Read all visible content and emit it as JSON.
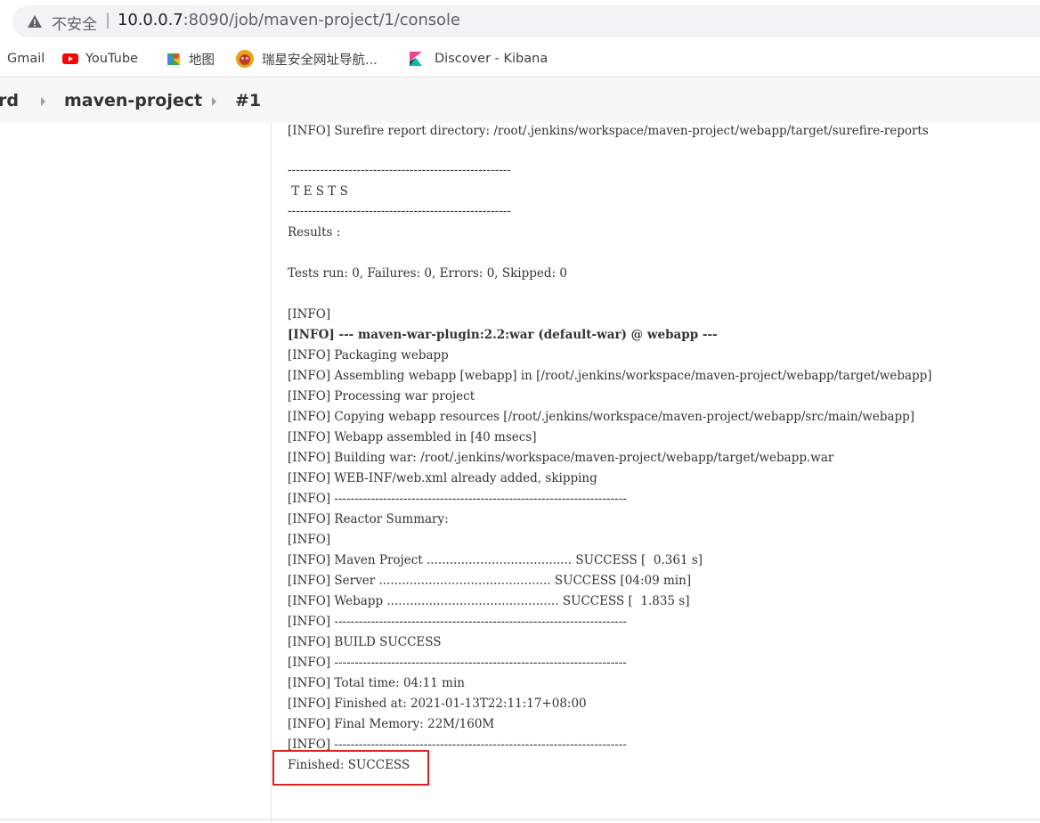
{
  "browser": {
    "security_label": "不安全",
    "separator": "|",
    "url_host": "10.0.0.7",
    "url_rest": ":8090/job/maven-project/1/console"
  },
  "bookmarks": [
    {
      "label": "Gmail",
      "icon": "gmail-icon"
    },
    {
      "label": "YouTube",
      "icon": "youtube-icon"
    },
    {
      "label": "地图",
      "icon": "maps-icon"
    },
    {
      "label": "瑞星安全网址导航...",
      "icon": "rising-lion-icon"
    },
    {
      "label": "Discover - Kibana",
      "icon": "kibana-icon"
    }
  ],
  "breadcrumb": {
    "items": [
      "rd",
      "maven-project",
      "#1"
    ]
  },
  "console": {
    "lines": [
      {
        "text": "[INFO] Surefire report directory: /root/.jenkins/workspace/maven-project/webapp/target/surefire-reports",
        "bold": false
      },
      {
        "text": "",
        "bold": false
      },
      {
        "text": "-------------------------------------------------------",
        "bold": false
      },
      {
        "text": " T E S T S",
        "bold": false
      },
      {
        "text": "-------------------------------------------------------",
        "bold": false
      },
      {
        "text": "Results :",
        "bold": false
      },
      {
        "text": "",
        "bold": false
      },
      {
        "text": "Tests run: 0, Failures: 0, Errors: 0, Skipped: 0",
        "bold": false
      },
      {
        "text": "",
        "bold": false
      },
      {
        "text": "[INFO]",
        "bold": false
      },
      {
        "text": "[INFO] --- maven-war-plugin:2.2:war (default-war) @ webapp ---",
        "bold": true
      },
      {
        "text": "[INFO] Packaging webapp",
        "bold": false
      },
      {
        "text": "[INFO] Assembling webapp [webapp] in [/root/.jenkins/workspace/maven-project/webapp/target/webapp]",
        "bold": false
      },
      {
        "text": "[INFO] Processing war project",
        "bold": false
      },
      {
        "text": "[INFO] Copying webapp resources [/root/.jenkins/workspace/maven-project/webapp/src/main/webapp]",
        "bold": false
      },
      {
        "text": "[INFO] Webapp assembled in [40 msecs]",
        "bold": false
      },
      {
        "text": "[INFO] Building war: /root/.jenkins/workspace/maven-project/webapp/target/webapp.war",
        "bold": false
      },
      {
        "text": "[INFO] WEB-INF/web.xml already added, skipping",
        "bold": false
      },
      {
        "text": "[INFO] ------------------------------------------------------------------------",
        "bold": false
      },
      {
        "text": "[INFO] Reactor Summary:",
        "bold": false
      },
      {
        "text": "[INFO]",
        "bold": false
      },
      {
        "text": "[INFO] Maven Project ...................................... SUCCESS [  0.361 s]",
        "bold": false
      },
      {
        "text": "[INFO] Server ............................................. SUCCESS [04:09 min]",
        "bold": false
      },
      {
        "text": "[INFO] Webapp ............................................. SUCCESS [  1.835 s]",
        "bold": false
      },
      {
        "text": "[INFO] ------------------------------------------------------------------------",
        "bold": false
      },
      {
        "text": "[INFO] BUILD SUCCESS",
        "bold": false
      },
      {
        "text": "[INFO] ------------------------------------------------------------------------",
        "bold": false
      },
      {
        "text": "[INFO] Total time: 04:11 min",
        "bold": false
      },
      {
        "text": "[INFO] Finished at: 2021-01-13T22:11:17+08:00",
        "bold": false
      },
      {
        "text": "[INFO] Final Memory: 22M/160M",
        "bold": false
      },
      {
        "text": "[INFO] ------------------------------------------------------------------------",
        "bold": false
      }
    ],
    "final_status": "Finished: SUCCESS"
  },
  "colors": {
    "highlight_border": "#e0201e",
    "youtube_red": "#ff0000"
  }
}
